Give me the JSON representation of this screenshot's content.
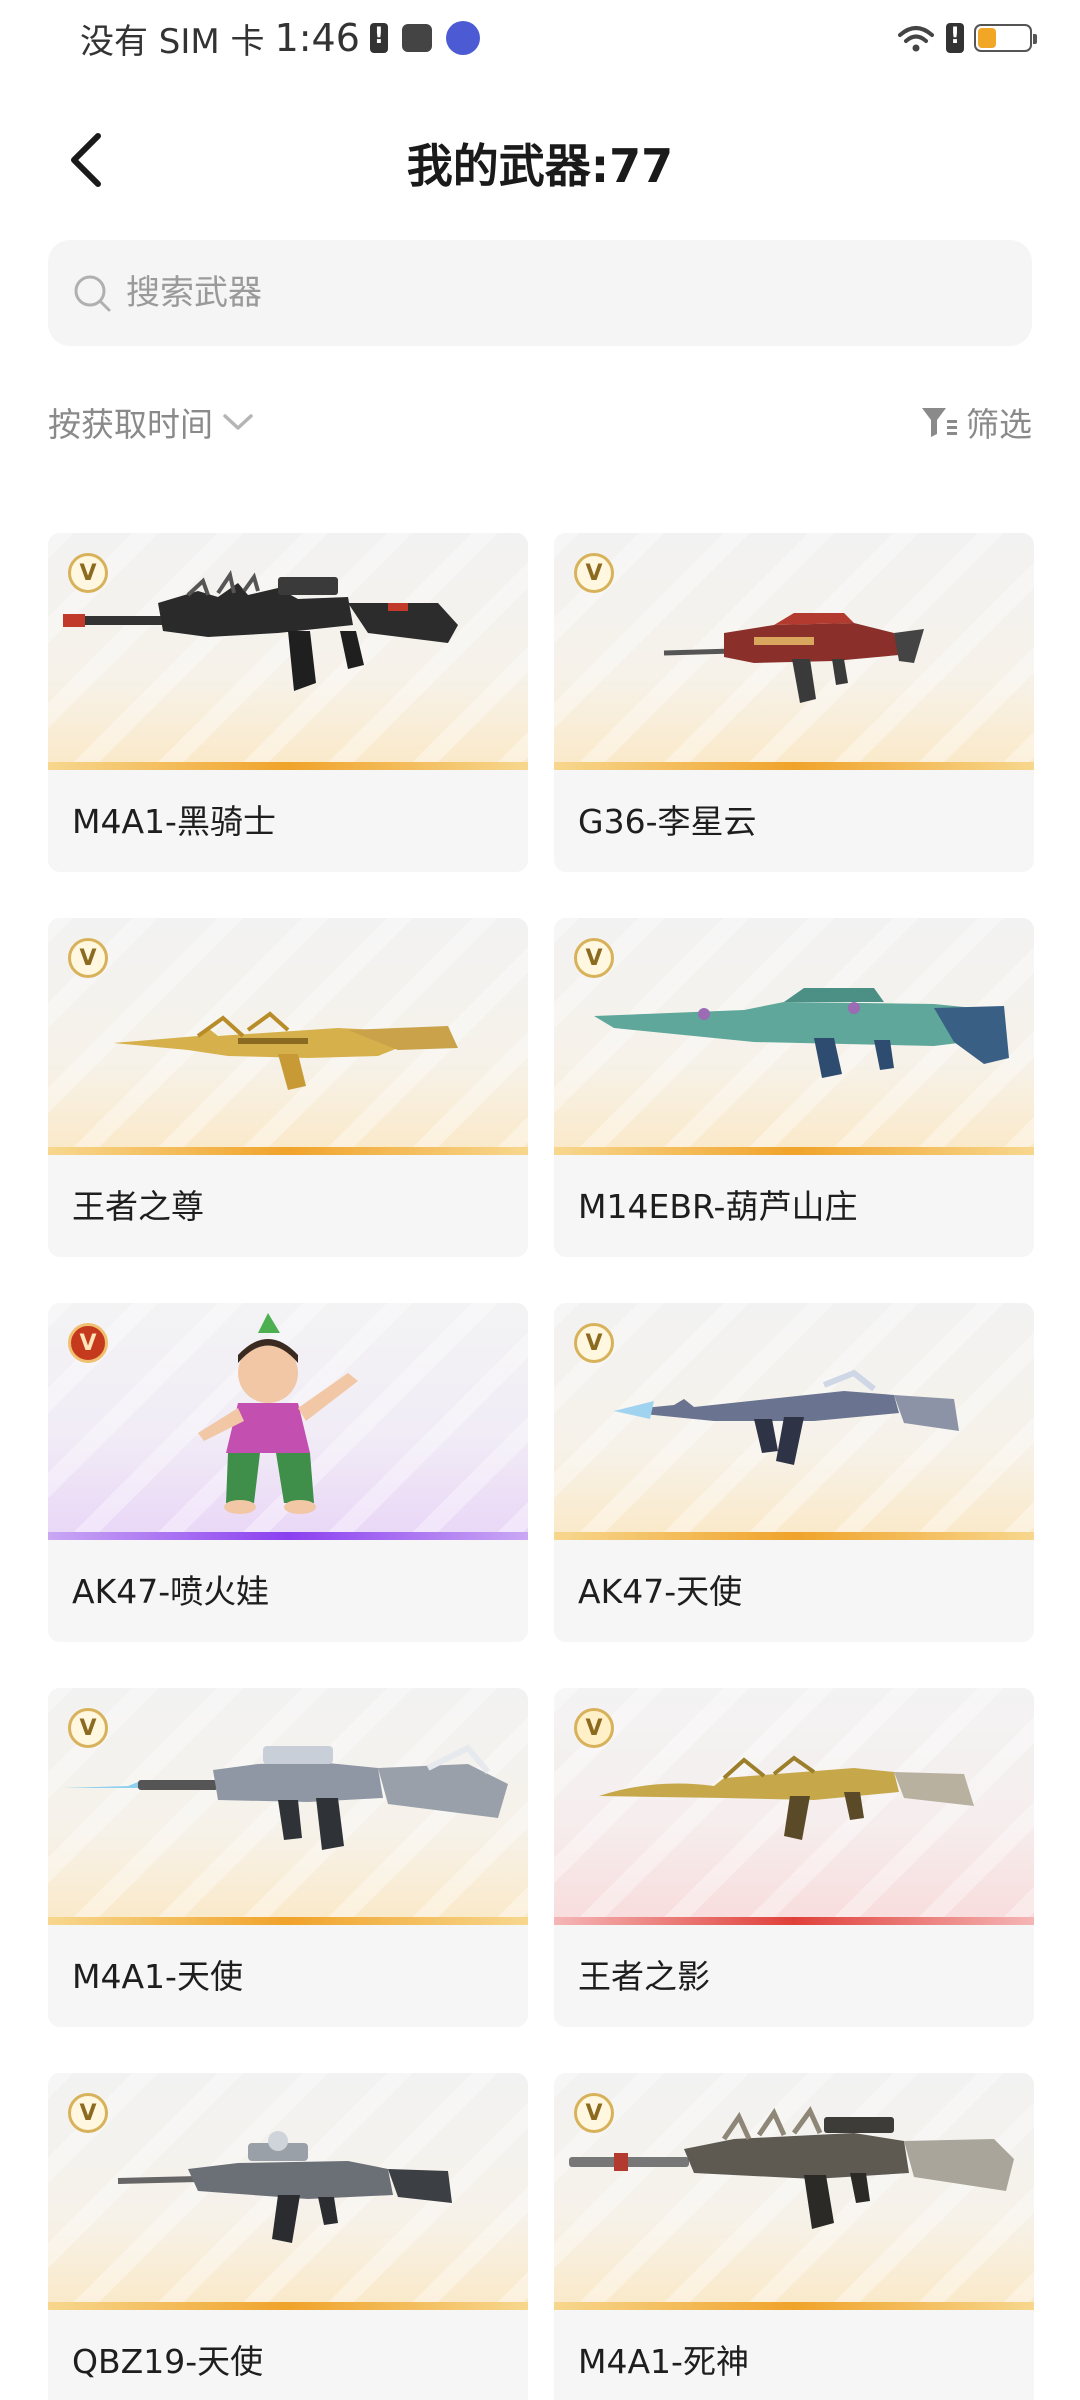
{
  "status_bar": {
    "carrier": "没有 SIM 卡",
    "time": "1:46"
  },
  "header": {
    "title": "我的武器:77"
  },
  "search": {
    "placeholder": "搜索武器"
  },
  "sort": {
    "label": "按获取时间"
  },
  "filter": {
    "label": "筛选"
  },
  "colors": {
    "gold_rarity": "#f0a32a",
    "purple_rarity": "#8b3ff0",
    "red_rarity": "#e0403a",
    "text_muted": "#8a8a8a"
  },
  "weapons": [
    {
      "name": "M4A1-黑骑士",
      "badge": "V",
      "rarity": "gold",
      "icon": "rifle-icon"
    },
    {
      "name": "G36-李星云",
      "badge": "V",
      "rarity": "gold",
      "icon": "rifle-icon"
    },
    {
      "name": "王者之尊",
      "badge": "V",
      "rarity": "gold",
      "icon": "rifle-icon"
    },
    {
      "name": "M14EBR-葫芦山庄",
      "badge": "V",
      "rarity": "gold",
      "icon": "rifle-icon"
    },
    {
      "name": "AK47-喷火娃",
      "badge": "V",
      "rarity": "purple",
      "icon": "character-icon"
    },
    {
      "name": "AK47-天使",
      "badge": "V",
      "rarity": "gold",
      "icon": "rifle-icon"
    },
    {
      "name": "M4A1-天使",
      "badge": "V",
      "rarity": "gold",
      "icon": "rifle-icon"
    },
    {
      "name": "王者之影",
      "badge": "V",
      "rarity": "red",
      "icon": "rifle-icon"
    },
    {
      "name": "QBZ19-天使",
      "badge": "V",
      "rarity": "gold",
      "icon": "rifle-icon"
    },
    {
      "name": "M4A1-死神",
      "badge": "V",
      "rarity": "gold",
      "icon": "rifle-icon"
    }
  ]
}
